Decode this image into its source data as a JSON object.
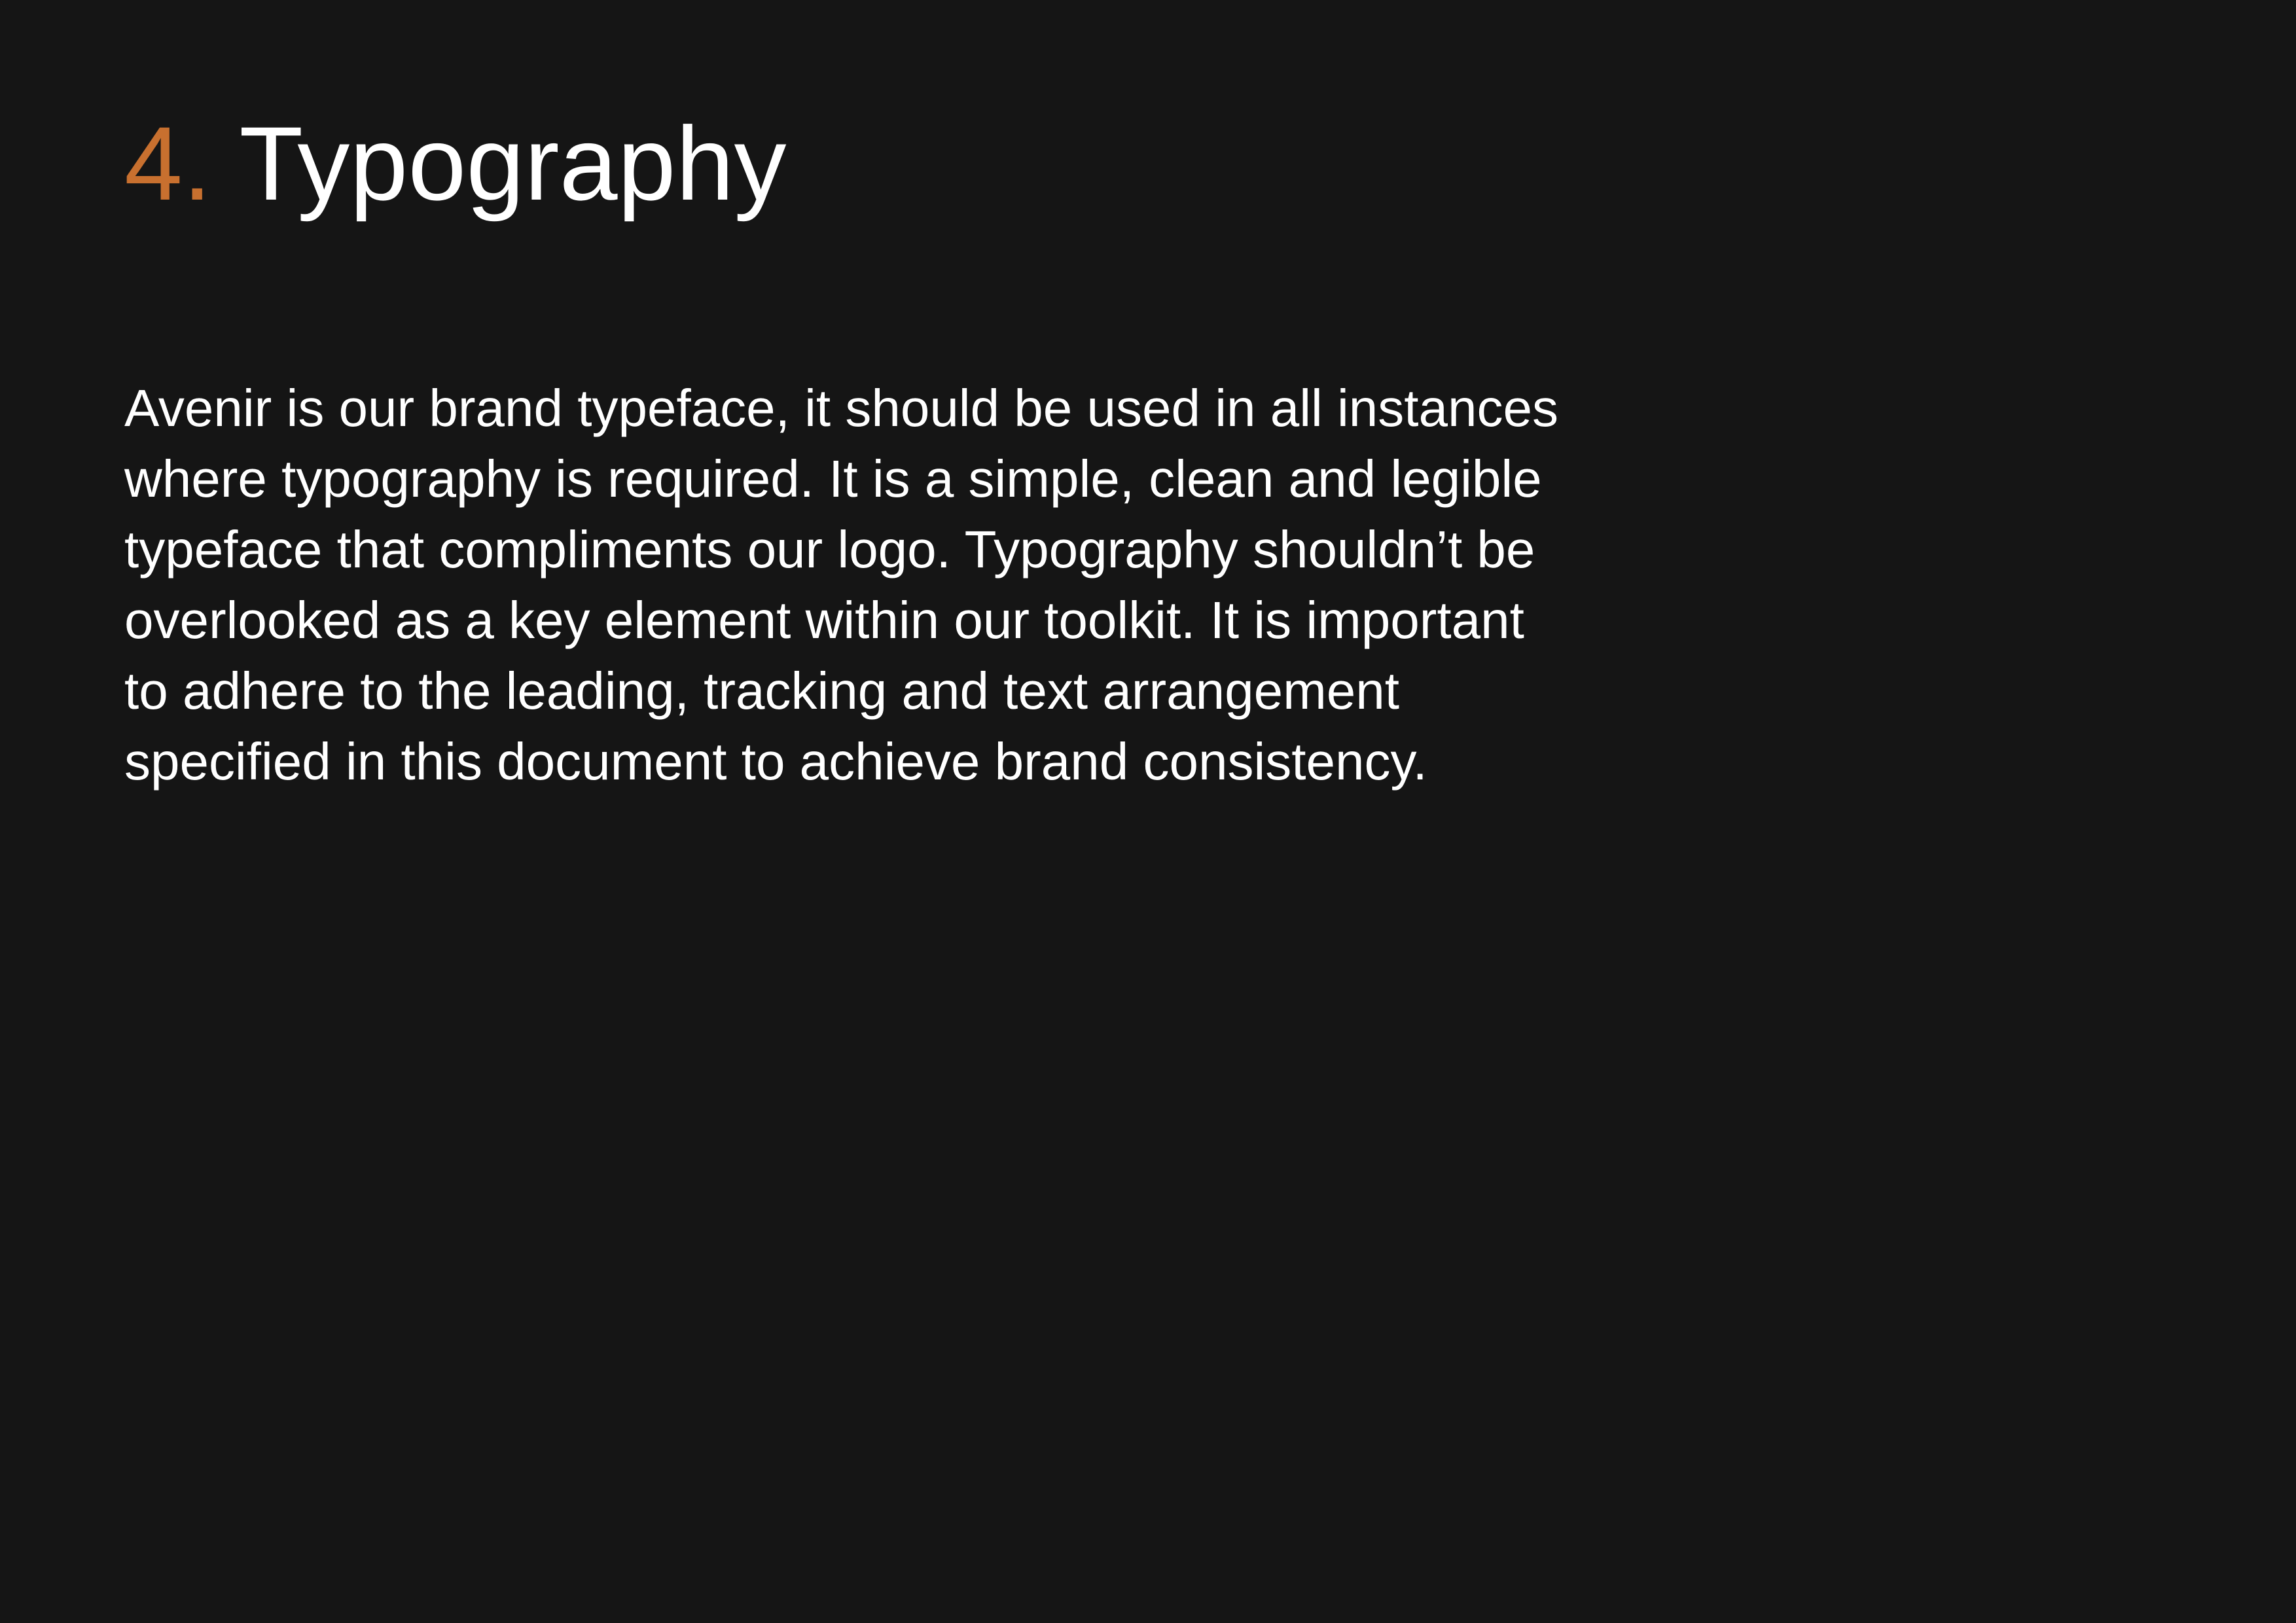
{
  "heading": {
    "number": "4.",
    "title": "Typography"
  },
  "body": {
    "lines": [
      "Avenir is our brand typeface, it should be used in all instances",
      "where typography is required. It is a simple, clean and legible",
      "typeface that compliments our logo. Typography shouldn’t be",
      "overlooked as a key element within our toolkit. It is important",
      "to adhere to the leading, tracking and text arrangement",
      "specified in this document to achieve brand consistency."
    ]
  },
  "colors": {
    "background": "#151515",
    "accent": "#c8702f",
    "text": "#ffffff"
  }
}
